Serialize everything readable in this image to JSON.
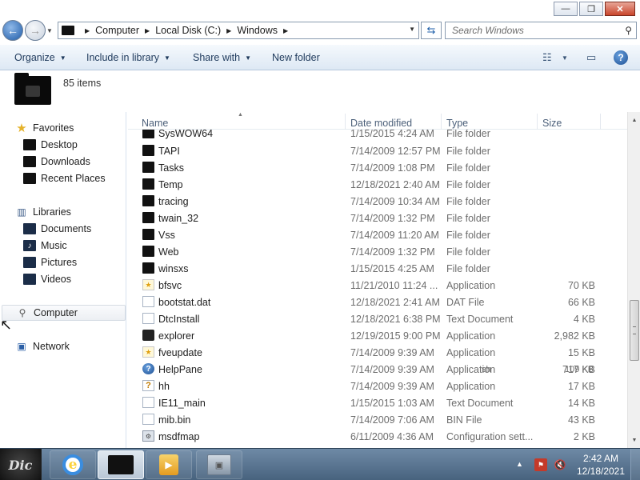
{
  "titlebar": {
    "minimize_glyph": "—",
    "maximize_glyph": "❐",
    "close_glyph": "✕"
  },
  "address": {
    "crumbs": [
      "Computer",
      "Local Disk (C:)",
      "Windows"
    ],
    "search_placeholder": "Search Windows"
  },
  "toolbar": {
    "organize": "Organize",
    "include_in_library": "Include in library",
    "share_with": "Share with",
    "new_folder": "New folder"
  },
  "details": {
    "items_count": "85 items"
  },
  "nav": {
    "favorites": "Favorites",
    "desktop": "Desktop",
    "downloads": "Downloads",
    "recent_places": "Recent Places",
    "libraries": "Libraries",
    "documents": "Documents",
    "music": "Music",
    "pictures": "Pictures",
    "videos": "Videos",
    "computer": "Computer",
    "network": "Network"
  },
  "columns": {
    "name": "Name",
    "date_modified": "Date modified",
    "type": "Type",
    "size": "Size"
  },
  "files": [
    {
      "name": "SysWOW64",
      "date": "1/15/2015 4:24 AM",
      "type": "File folder",
      "size": "",
      "icon": "folder"
    },
    {
      "name": "TAPI",
      "date": "7/14/2009 12:57 PM",
      "type": "File folder",
      "size": "",
      "icon": "folder"
    },
    {
      "name": "Tasks",
      "date": "7/14/2009 1:08 PM",
      "type": "File folder",
      "size": "",
      "icon": "folder"
    },
    {
      "name": "Temp",
      "date": "12/18/2021 2:40 AM",
      "type": "File folder",
      "size": "",
      "icon": "folder"
    },
    {
      "name": "tracing",
      "date": "7/14/2009 10:34 AM",
      "type": "File folder",
      "size": "",
      "icon": "folder"
    },
    {
      "name": "twain_32",
      "date": "7/14/2009 1:32 PM",
      "type": "File folder",
      "size": "",
      "icon": "folder"
    },
    {
      "name": "Vss",
      "date": "7/14/2009 11:20 AM",
      "type": "File folder",
      "size": "",
      "icon": "folder"
    },
    {
      "name": "Web",
      "date": "7/14/2009 1:32 PM",
      "type": "File folder",
      "size": "",
      "icon": "folder"
    },
    {
      "name": "winsxs",
      "date": "1/15/2015 4:25 AM",
      "type": "File folder",
      "size": "",
      "icon": "folder"
    },
    {
      "name": "bfsvc",
      "date": "11/21/2010 11:24 ...",
      "type": "Application",
      "size": "70 KB",
      "icon": "app"
    },
    {
      "name": "bootstat.dat",
      "date": "12/18/2021 2:41 AM",
      "type": "DAT File",
      "size": "66 KB",
      "icon": "file"
    },
    {
      "name": "DtcInstall",
      "date": "12/18/2021 6:38 PM",
      "type": "Text Document",
      "size": "4 KB",
      "icon": "file"
    },
    {
      "name": "explorer",
      "date": "12/19/2015 9:00 PM",
      "type": "Application",
      "size": "2,982 KB",
      "icon": "exp"
    },
    {
      "name": "fveupdate",
      "date": "7/14/2009 9:39 AM",
      "type": "Application",
      "size": "15 KB",
      "icon": "app"
    },
    {
      "name": "HelpPane",
      "date": "7/14/2009 9:39 AM",
      "type": "Application",
      "size": "717 KB",
      "icon": "help"
    },
    {
      "name": "hh",
      "date": "7/14/2009 9:39 AM",
      "type": "Application",
      "size": "17 KB",
      "icon": "hh"
    },
    {
      "name": "IE11_main",
      "date": "1/15/2015 1:03 AM",
      "type": "Text Document",
      "size": "14 KB",
      "icon": "file"
    },
    {
      "name": "mib.bin",
      "date": "7/14/2009 7:06 AM",
      "type": "BIN File",
      "size": "43 KB",
      "icon": "file"
    },
    {
      "name": "msdfmap",
      "date": "6/11/2009 4:36 AM",
      "type": "Configuration sett...",
      "size": "2 KB",
      "icon": "cfg"
    }
  ],
  "overlay": {
    "sh": "sh",
    "kb": "109 KB"
  },
  "taskbar": {
    "start_label": "Dic",
    "ie_glyph": "e",
    "time": "2:42 AM",
    "date": "12/18/2021"
  },
  "icons": {
    "favorites_star": "★",
    "libraries": "▥",
    "computer": "🖳",
    "network": "🖧",
    "music": "♪"
  }
}
